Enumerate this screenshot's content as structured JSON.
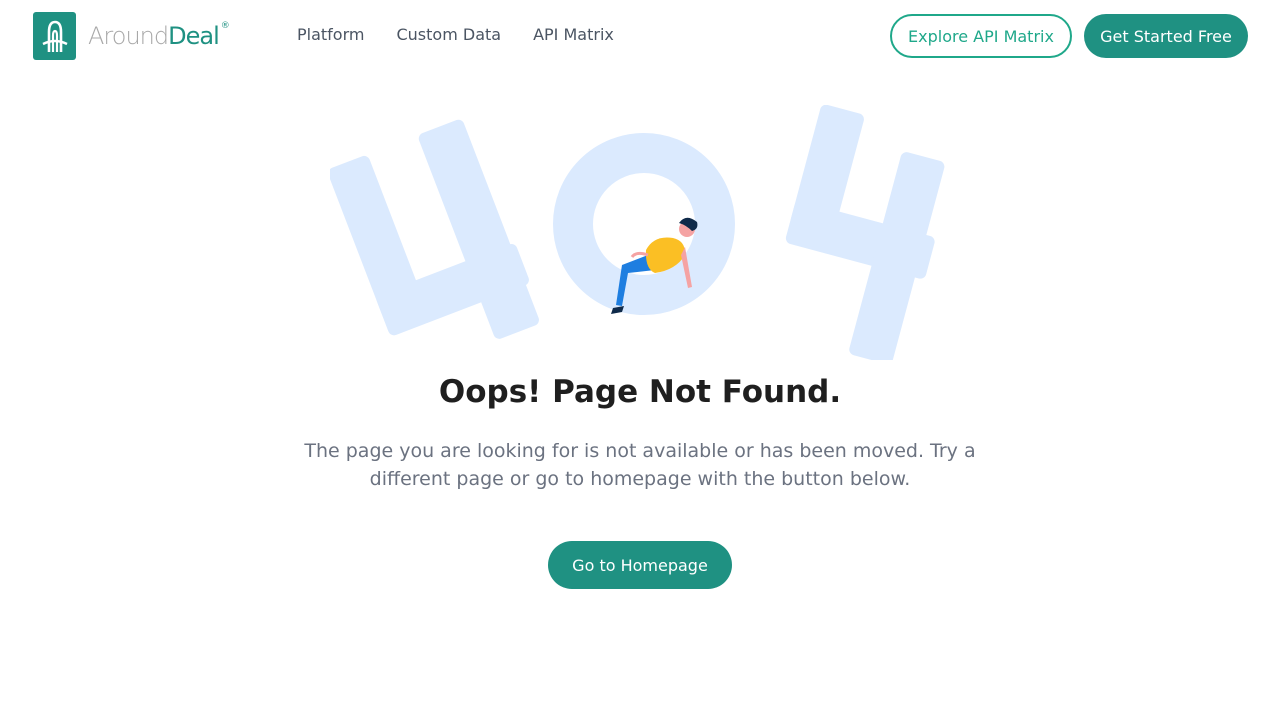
{
  "header": {
    "logo": {
      "text_around": "Around",
      "text_deal": "Deal",
      "registered": "®",
      "brand_color": "#1f9182"
    },
    "nav": [
      {
        "label": "Platform"
      },
      {
        "label": "Custom Data"
      },
      {
        "label": "API Matrix"
      }
    ],
    "explore_button": "Explore API Matrix",
    "get_started_button": "Get Started Free"
  },
  "main": {
    "illustration": {
      "icon": "404-illustration-icon",
      "color": "#dbeafe"
    },
    "title": "Oops! Page Not Found.",
    "description": "The page you are looking for is not available or has been moved. Try a different page or go to homepage with the button below.",
    "home_button": "Go to Homepage"
  },
  "colors": {
    "accent": "#1f9182",
    "accent_outline": "#1fa88a",
    "text_dark": "#1f1f1f",
    "text_muted": "#6b7280"
  }
}
